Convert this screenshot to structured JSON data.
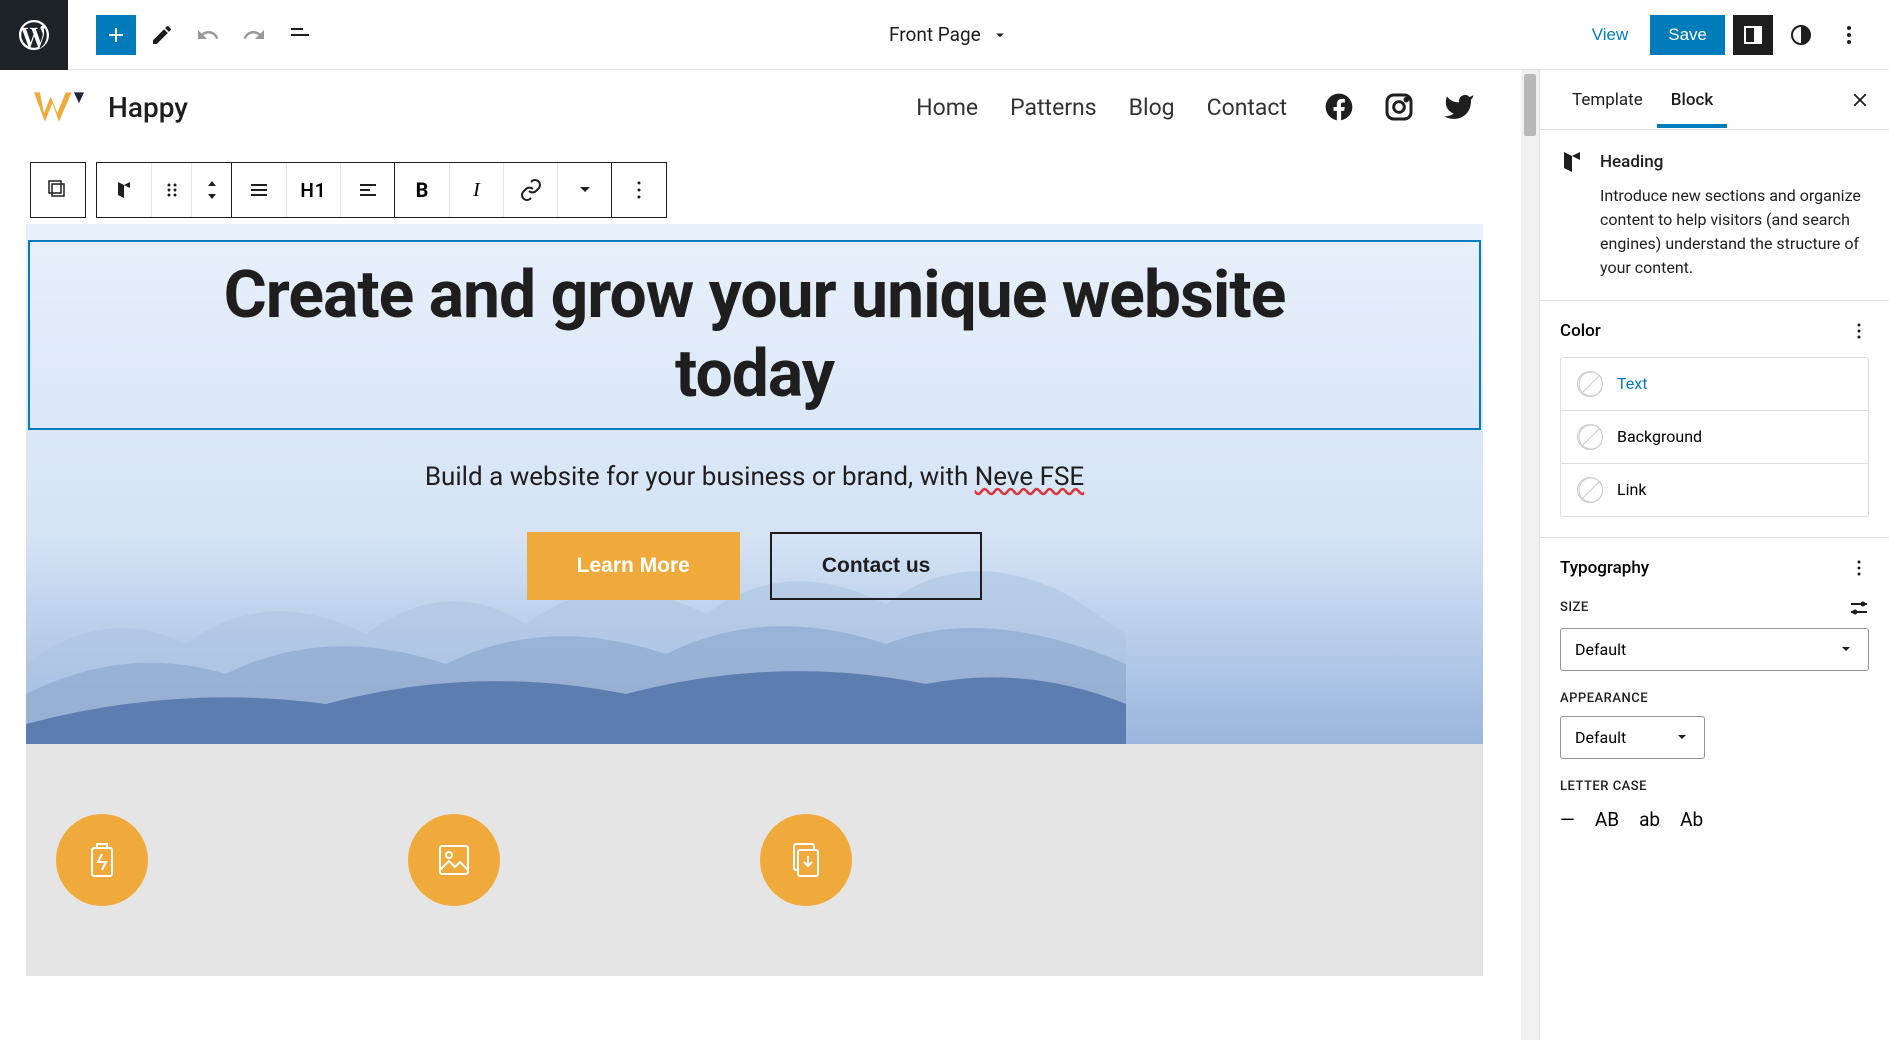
{
  "topbar": {
    "page_title": "Front Page",
    "view": "View",
    "save": "Save"
  },
  "site": {
    "title": "Happy",
    "nav": [
      "Home",
      "Patterns",
      "Blog",
      "Contact"
    ]
  },
  "toolbar": {
    "heading_level": "H1"
  },
  "hero": {
    "heading": "Create and grow your unique website today",
    "subhead_prefix": "Build a website for your business or brand, with ",
    "subhead_suffix": "Neve FSE",
    "cta_primary": "Learn More",
    "cta_secondary": "Contact us"
  },
  "sidebar": {
    "tabs": {
      "template": "Template",
      "block": "Block"
    },
    "block_info": {
      "title": "Heading",
      "desc": "Introduce new sections and organize content to help visitors (and search engines) understand the structure of your content."
    },
    "color": {
      "title": "Color",
      "rows": {
        "text": "Text",
        "background": "Background",
        "link": "Link"
      }
    },
    "typography": {
      "title": "Typography",
      "size_label": "SIZE",
      "size_value": "Default",
      "appearance_label": "APPEARANCE",
      "appearance_value": "Default",
      "lettercase_label": "LETTER CASE",
      "lettercase_options": [
        "—",
        "AB",
        "ab",
        "Ab"
      ]
    }
  }
}
